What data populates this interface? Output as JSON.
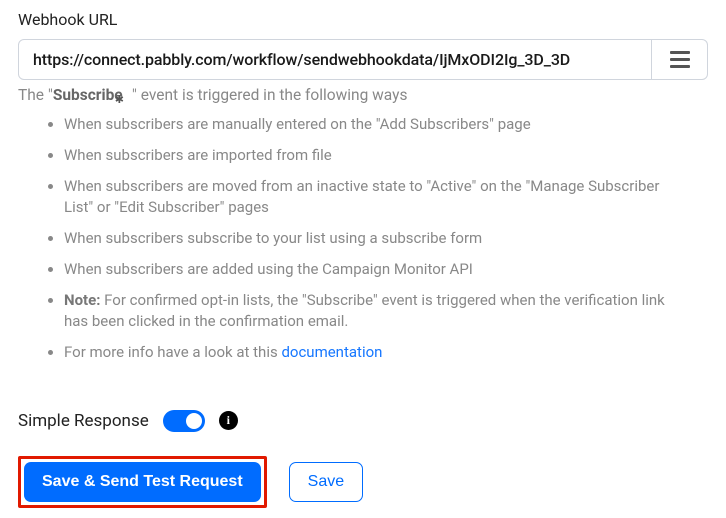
{
  "webhook": {
    "label": "Webhook URL",
    "url": "https://connect.pabbly.com/workflow/sendwebhookdata/IjMxODI2Ig_3D_3D"
  },
  "description": {
    "prefix": "The \"",
    "event": "Subscribe",
    "suffix": "\" event is triggered in the following ways"
  },
  "bullets": [
    {
      "text": "When subscribers are manually entered on the \"Add Subscribers\" page"
    },
    {
      "text": "When subscribers are imported from file"
    },
    {
      "text": "When subscribers are moved from an inactive state to \"Active\" on the \"Manage Subscriber List\" or \"Edit Subscriber\" pages"
    },
    {
      "text": "When subscribers subscribe to your list using a subscribe form"
    },
    {
      "text": "When subscribers are added using the Campaign Monitor API"
    },
    {
      "bold": "Note:",
      "text": " For confirmed opt-in lists, the \"Subscribe\" event is triggered when the verification link has been clicked in the confirmation email."
    },
    {
      "text": "For more info have a look at this ",
      "link": "documentation"
    }
  ],
  "simpleResponse": {
    "label": "Simple Response",
    "enabled": true
  },
  "buttons": {
    "primary": "Save & Send Test Request",
    "secondary": "Save"
  },
  "infoGlyph": "i"
}
